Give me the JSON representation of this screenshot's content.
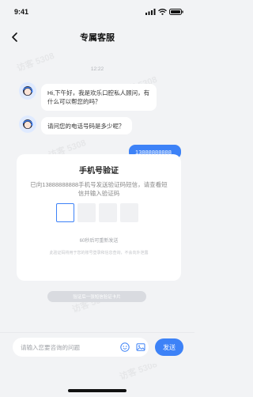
{
  "status_bar": {
    "time": "9:41"
  },
  "nav": {
    "title": "专属客服"
  },
  "chat": {
    "timestamp": "12:22",
    "messages": [
      {
        "from": "agent",
        "text": "Hi,下午好，我是欢乐口腔私人顾问，有什么可以帮您的吗？"
      },
      {
        "from": "agent",
        "text": "请问您的电话号码是多少呢？"
      },
      {
        "from": "user",
        "text": "13888888888"
      }
    ]
  },
  "verify_card": {
    "title": "手机号验证",
    "description": "已向13888888888手机号发送验证码短信，请查看短信并输入验证码",
    "resend": "60秒后可重新发送",
    "hint": "此验证码将用于您的账号登录和信息查询，不会向外泄露"
  },
  "notice_pill": "验证后一张短信验证卡片",
  "input_bar": {
    "placeholder": "请输入您要咨询的问题",
    "send_label": "发送"
  },
  "watermark": "访客 5308",
  "colors": {
    "accent": "#3d82f7",
    "background": "#f2f3f5"
  },
  "icons": [
    "back-arrow-icon",
    "signal-icon",
    "wifi-icon",
    "battery-icon",
    "agent-avatar-icon",
    "emoji-icon",
    "image-icon"
  ]
}
